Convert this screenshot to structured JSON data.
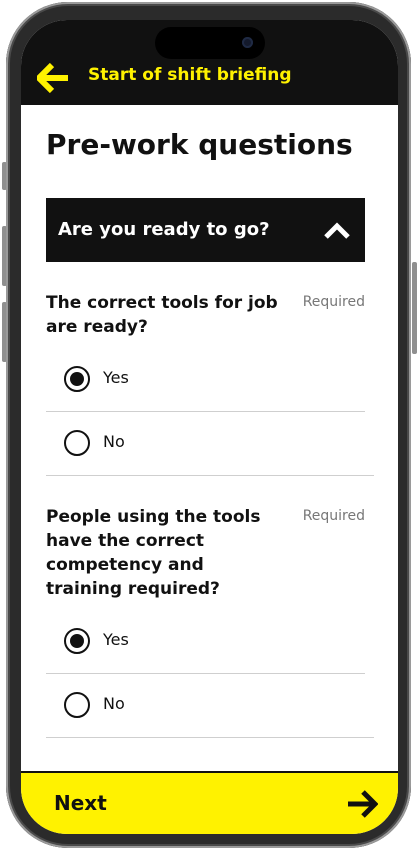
{
  "header": {
    "title": "Start of shift briefing",
    "back_icon": "arrow-left-icon"
  },
  "page": {
    "title": "Pre-work questions"
  },
  "section": {
    "label": "Are you ready to go?",
    "state": "expanded",
    "toggle_icon": "chevron-up-icon"
  },
  "questions": [
    {
      "text": "The correct tools for job are ready?",
      "required_label": "Required",
      "options": [
        {
          "label": "Yes",
          "selected": true
        },
        {
          "label": "No",
          "selected": false
        }
      ]
    },
    {
      "text": "People using the tools have the correct competency and training required?",
      "required_label": "Required",
      "options": [
        {
          "label": "Yes",
          "selected": true
        },
        {
          "label": "No",
          "selected": false
        }
      ]
    }
  ],
  "footer": {
    "next_label": "Next",
    "next_icon": "arrow-right-icon"
  },
  "colors": {
    "brand_yellow": "#fff200",
    "dark": "#111111",
    "muted": "#777777"
  }
}
